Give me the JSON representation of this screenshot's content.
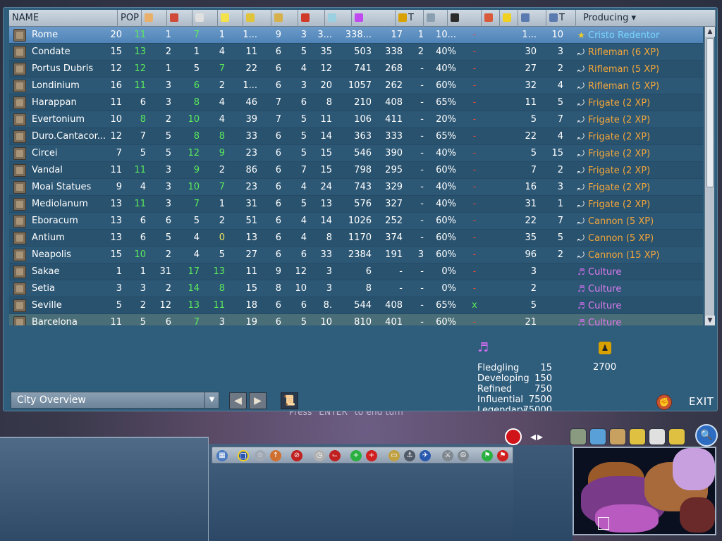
{
  "window": {
    "title": "City Overview"
  },
  "columns": [
    {
      "key": "name",
      "label": "NAME"
    },
    {
      "key": "pop",
      "label": "POP"
    },
    {
      "key": "food",
      "label": "",
      "icon": "food-icon",
      "color": "#e8b06a"
    },
    {
      "key": "prod",
      "label": "",
      "icon": "production-icon",
      "color": "#d04a3a"
    },
    {
      "key": "health",
      "label": "",
      "icon": "health-icon",
      "color": "#e0e0e0"
    },
    {
      "key": "happy",
      "label": "",
      "icon": "happy-icon",
      "color": "#f3e24a"
    },
    {
      "key": "commerce",
      "label": "",
      "icon": "commerce-icon",
      "color": "#e0c43a"
    },
    {
      "key": "trade",
      "label": "",
      "icon": "trade-icon",
      "color": "#d6b04a"
    },
    {
      "key": "culture2",
      "label": "",
      "icon": "culture-rate-icon",
      "color": "#d03a2a"
    },
    {
      "key": "science",
      "label": "",
      "icon": "science-icon",
      "color": "#9ad0e0"
    },
    {
      "key": "culture",
      "label": "",
      "icon": "culture-icon",
      "color": "#c04af0"
    },
    {
      "key": "t1",
      "label": "T",
      "icon": "great-person-icon",
      "color": "#d8a100"
    },
    {
      "key": "specialists",
      "label": "",
      "icon": "specialist-icon",
      "color": "#8aa0b0"
    },
    {
      "key": "progress",
      "label": "",
      "icon": "hourglass-icon",
      "color": "#2a2a2a"
    },
    {
      "key": "defense",
      "label": "",
      "icon": "defense-icon",
      "color": "#d85a3a"
    },
    {
      "key": "power",
      "label": "",
      "icon": "power-icon",
      "color": "#f0d020"
    },
    {
      "key": "espionage",
      "label": "",
      "icon": "espionage-icon",
      "color": "#5a7ab0"
    },
    {
      "key": "t2",
      "label": "T",
      "icon": "espionage-turns-icon",
      "color": "#5a7ab0"
    },
    {
      "key": "producing",
      "label": "Producing"
    }
  ],
  "rows": [
    {
      "name": "Rome",
      "pop": "20",
      "food": "11",
      "prod": "1",
      "health": "7",
      "happy": "1",
      "commerce": "1...",
      "trade": "9",
      "culture2": "3",
      "science": "3...",
      "culture": "338...",
      "t1": "17",
      "specialists": "1",
      "progress": "10...",
      "defense": "-",
      "espionage": "1...",
      "t2": "10",
      "producing": "Cristo Redentor",
      "prodtype": "wonder"
    },
    {
      "name": "Condate",
      "pop": "15",
      "food": "13",
      "prod": "2",
      "health": "1",
      "happy": "4",
      "commerce": "11",
      "trade": "6",
      "culture2": "5",
      "science": "35",
      "culture": "503",
      "t1": "338",
      "specialists": "2",
      "progress": "40%",
      "defense": "-",
      "espionage": "30",
      "t2": "3",
      "producing": "Rifleman (6 XP)",
      "prodtype": "unit"
    },
    {
      "name": "Portus Dubris",
      "pop": "12",
      "food": "12",
      "prod": "1",
      "health": "5",
      "happy": "7",
      "commerce": "22",
      "trade": "6",
      "culture2": "4",
      "science": "12",
      "culture": "741",
      "t1": "268",
      "specialists": "-",
      "progress": "40%",
      "defense": "-",
      "espionage": "27",
      "t2": "2",
      "producing": "Rifleman (5 XP)",
      "prodtype": "unit"
    },
    {
      "name": "Londinium",
      "pop": "16",
      "food": "11",
      "prod": "3",
      "health": "6",
      "happy": "2",
      "commerce": "1...",
      "trade": "6",
      "culture2": "3",
      "science": "20",
      "culture": "1057",
      "t1": "262",
      "specialists": "-",
      "progress": "60%",
      "defense": "-",
      "espionage": "32",
      "t2": "4",
      "producing": "Rifleman (5 XP)",
      "prodtype": "unit"
    },
    {
      "name": "Harappan",
      "pop": "11",
      "food": "6",
      "prod": "3",
      "health": "8",
      "happy": "4",
      "commerce": "46",
      "trade": "7",
      "culture2": "6",
      "science": "8",
      "culture": "210",
      "t1": "408",
      "specialists": "-",
      "progress": "65%",
      "defense": "-",
      "espionage": "11",
      "t2": "5",
      "producing": "Frigate (2 XP)",
      "prodtype": "unit"
    },
    {
      "name": "Evertonium",
      "pop": "10",
      "food": "8",
      "prod": "2",
      "health": "10",
      "happy": "4",
      "commerce": "39",
      "trade": "7",
      "culture2": "5",
      "science": "11",
      "culture": "106",
      "t1": "411",
      "specialists": "-",
      "progress": "20%",
      "defense": "-",
      "espionage": "5",
      "t2": "7",
      "producing": "Frigate (2 XP)",
      "prodtype": "unit"
    },
    {
      "name": "Duro.Cantacor...",
      "pop": "12",
      "food": "7",
      "prod": "5",
      "health": "8",
      "happy": "8",
      "commerce": "33",
      "trade": "6",
      "culture2": "5",
      "science": "14",
      "culture": "363",
      "t1": "333",
      "specialists": "-",
      "progress": "65%",
      "defense": "-",
      "espionage": "22",
      "t2": "4",
      "producing": "Frigate (2 XP)",
      "prodtype": "unit"
    },
    {
      "name": "Circei",
      "pop": "7",
      "food": "5",
      "prod": "5",
      "health": "12",
      "happy": "9",
      "commerce": "23",
      "trade": "6",
      "culture2": "5",
      "science": "15",
      "culture": "546",
      "t1": "390",
      "specialists": "-",
      "progress": "40%",
      "defense": "-",
      "espionage": "5",
      "t2": "15",
      "producing": "Frigate (2 XP)",
      "prodtype": "unit"
    },
    {
      "name": "Vandal",
      "pop": "11",
      "food": "11",
      "prod": "3",
      "health": "9",
      "happy": "2",
      "commerce": "86",
      "trade": "6",
      "culture2": "7",
      "science": "15",
      "culture": "798",
      "t1": "295",
      "specialists": "-",
      "progress": "60%",
      "defense": "-",
      "espionage": "7",
      "t2": "2",
      "producing": "Frigate (2 XP)",
      "prodtype": "unit"
    },
    {
      "name": "Moai Statues",
      "pop": "9",
      "food": "4",
      "prod": "3",
      "health": "10",
      "happy": "7",
      "commerce": "23",
      "trade": "6",
      "culture2": "4",
      "science": "24",
      "culture": "743",
      "t1": "329",
      "specialists": "-",
      "progress": "40%",
      "defense": "-",
      "espionage": "16",
      "t2": "3",
      "producing": "Frigate (2 XP)",
      "prodtype": "unit"
    },
    {
      "name": "Mediolanum",
      "pop": "13",
      "food": "11",
      "prod": "3",
      "health": "7",
      "happy": "1",
      "commerce": "31",
      "trade": "6",
      "culture2": "5",
      "science": "13",
      "culture": "576",
      "t1": "327",
      "specialists": "-",
      "progress": "40%",
      "defense": "-",
      "espionage": "31",
      "t2": "1",
      "producing": "Frigate (2 XP)",
      "prodtype": "unit"
    },
    {
      "name": "Eboracum",
      "pop": "13",
      "food": "6",
      "prod": "6",
      "health": "5",
      "happy": "2",
      "commerce": "51",
      "trade": "6",
      "culture2": "4",
      "science": "14",
      "culture": "1026",
      "t1": "252",
      "specialists": "-",
      "progress": "60%",
      "defense": "-",
      "espionage": "22",
      "t2": "7",
      "producing": "Cannon (5 XP)",
      "prodtype": "unit"
    },
    {
      "name": "Antium",
      "pop": "13",
      "food": "6",
      "prod": "5",
      "health": "4",
      "happy": "0",
      "commerce": "13",
      "trade": "6",
      "culture2": "4",
      "science": "8",
      "culture": "1170",
      "t1": "374",
      "specialists": "-",
      "progress": "60%",
      "defense": "-",
      "espionage": "35",
      "t2": "5",
      "producing": "Cannon (5 XP)",
      "prodtype": "unit"
    },
    {
      "name": "Neapolis",
      "pop": "15",
      "food": "10",
      "prod": "2",
      "health": "4",
      "happy": "5",
      "commerce": "27",
      "trade": "6",
      "culture2": "6",
      "science": "33",
      "culture": "2384",
      "t1": "191",
      "specialists": "3",
      "progress": "60%",
      "defense": "-",
      "espionage": "96",
      "t2": "2",
      "producing": "Cannon (15 XP)",
      "prodtype": "unit"
    },
    {
      "name": "Sakae",
      "pop": "1",
      "food": "1",
      "prod": "31",
      "health": "17",
      "happy": "13",
      "commerce": "11",
      "trade": "9",
      "culture2": "12",
      "science": "3",
      "culture": "6",
      "t1": "-",
      "specialists": "-",
      "progress": "0%",
      "defense": "-",
      "espionage": "3",
      "t2": "",
      "producing": "Culture",
      "prodtype": "culture"
    },
    {
      "name": "Setia",
      "pop": "3",
      "food": "3",
      "prod": "2",
      "health": "14",
      "happy": "8",
      "commerce": "15",
      "trade": "8",
      "culture2": "10",
      "science": "3",
      "culture": "8",
      "t1": "-",
      "specialists": "-",
      "progress": "0%",
      "defense": "-",
      "espionage": "2",
      "t2": "",
      "producing": "Culture",
      "prodtype": "culture"
    },
    {
      "name": "Seville",
      "pop": "5",
      "food": "2",
      "prod": "12",
      "health": "13",
      "happy": "11",
      "commerce": "18",
      "trade": "6",
      "culture2": "6",
      "science": "8.",
      "culture": "544",
      "t1": "408",
      "specialists": "-",
      "progress": "65%",
      "defense": "x",
      "espionage": "5",
      "t2": "",
      "producing": "Culture",
      "prodtype": "culture"
    },
    {
      "name": "Barcelona",
      "pop": "11",
      "food": "5",
      "prod": "6",
      "health": "7",
      "happy": "3",
      "commerce": "19",
      "trade": "6",
      "culture2": "5",
      "science": "10",
      "culture": "810",
      "t1": "401",
      "specialists": "-",
      "progress": "60%",
      "defense": "-",
      "espionage": "21",
      "t2": "",
      "producing": "Culture",
      "prodtype": "culture"
    }
  ],
  "legend": {
    "levels": [
      {
        "label": "Fledgling",
        "value": "15"
      },
      {
        "label": "Developing",
        "value": "150"
      },
      {
        "label": "Refined",
        "value": "750"
      },
      {
        "label": "Influential",
        "value": "7500"
      },
      {
        "label": "Legendary",
        "value": "75000"
      }
    ],
    "gp_value": "2700"
  },
  "footer": {
    "dropdown": "City Overview",
    "exit": "EXIT"
  },
  "hint": "Press \"ENTER\" to end turn"
}
